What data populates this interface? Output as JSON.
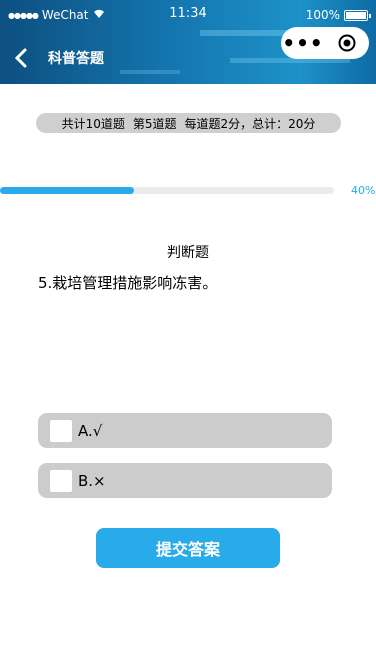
{
  "status_bar": {
    "carrier": "WeChat",
    "time": "11:34",
    "battery": "100%"
  },
  "nav": {
    "title": "科普答题"
  },
  "summary": {
    "total": "共计10道题",
    "current": "第5道题",
    "score": "每道题2分，总计：20分"
  },
  "progress": {
    "value": 0.4,
    "label": "40%"
  },
  "question": {
    "type": "判断题",
    "text": "5.栽培管理措施影响冻害。"
  },
  "options": [
    {
      "label": "A.√"
    },
    {
      "label": "B.×"
    }
  ],
  "submit_label": "提交答案",
  "colors": {
    "accent": "#29aae9",
    "option_bg": "#cccccc"
  }
}
